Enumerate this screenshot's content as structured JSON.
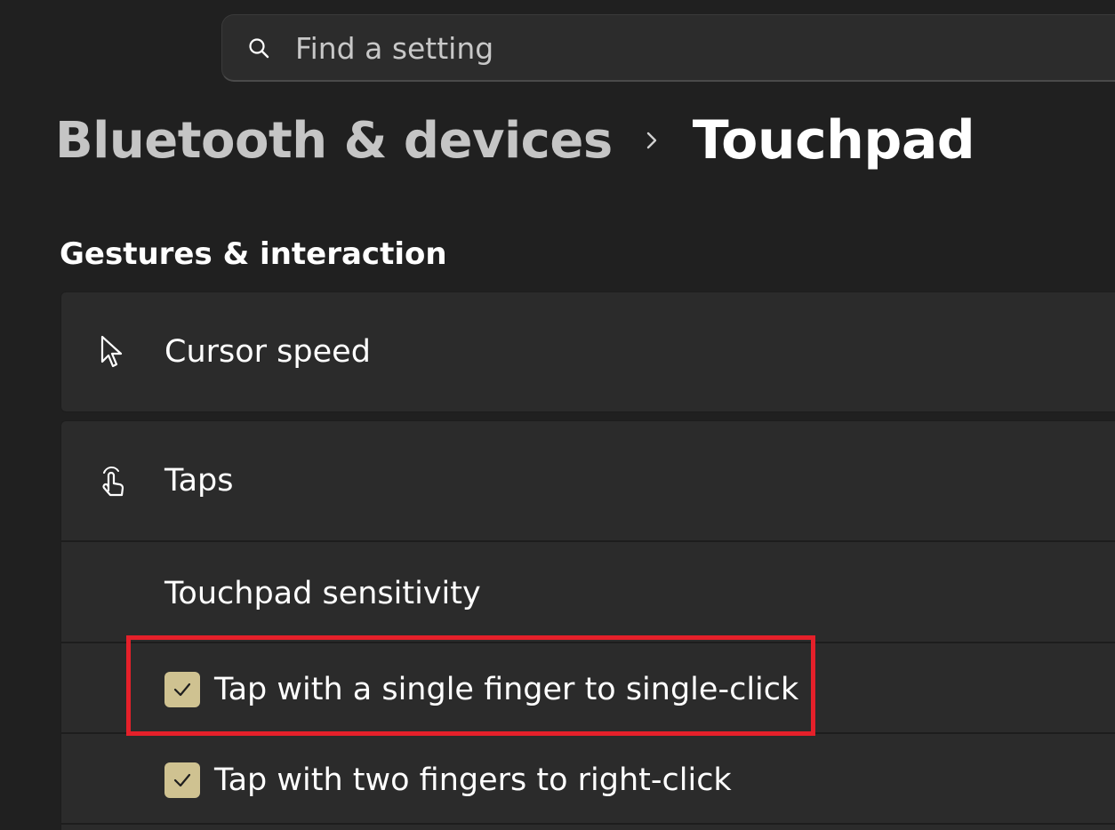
{
  "search": {
    "placeholder": "Find a setting",
    "icon": "search-icon"
  },
  "breadcrumb": {
    "parent": "Bluetooth & devices",
    "separator_icon": "chevron-right-icon",
    "current": "Touchpad"
  },
  "section": {
    "title": "Gestures & interaction"
  },
  "cursor_speed": {
    "label": "Cursor speed",
    "icon": "cursor-icon"
  },
  "taps": {
    "label": "Taps",
    "icon": "tap-gesture-icon",
    "sensitivity_label": "Touchpad sensitivity",
    "options": [
      {
        "label": "Tap with a single finger to single-click",
        "checked": true,
        "highlighted": true
      },
      {
        "label": "Tap with two fingers to right-click",
        "checked": true,
        "highlighted": false
      }
    ]
  },
  "colors": {
    "background": "#202020",
    "card": "#2b2b2b",
    "checkbox_accent": "#cfc291",
    "highlight": "#e5202a"
  }
}
